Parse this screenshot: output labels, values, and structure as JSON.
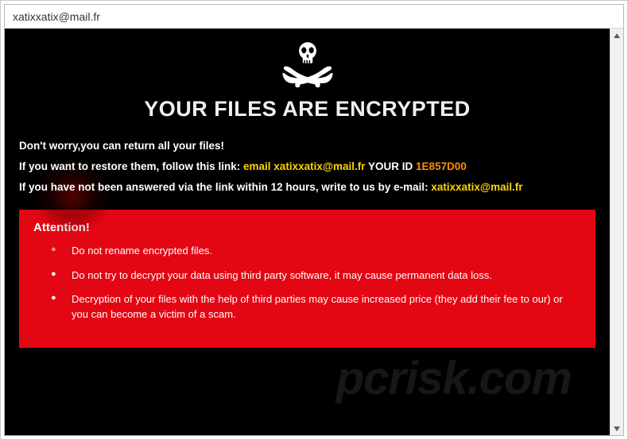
{
  "window": {
    "title": "xatixxatix@mail.fr"
  },
  "heading": "YOUR FILES ARE ENCRYPTED",
  "line1": "Don't worry,you can return all your files!",
  "line2": {
    "prefix": "If you want to restore them, follow this link: ",
    "email_label": "email xatixxatix@mail.fr",
    "id_label": "  YOUR ID ",
    "id_value": "1E857D00"
  },
  "line3": {
    "prefix": "If you have not been answered via the link ",
    "mid": "within 12 hours, write to us by e-mail: ",
    "email": "xatixxatix@mail.fr"
  },
  "attention": {
    "title": "Attention!",
    "items": [
      "Do not rename encrypted files.",
      "Do not try to decrypt your data using third party software, it may cause permanent data loss.",
      "Decryption of your files with the help of third parties may cause increased price (they add their fee to our) or you can become a victim of a scam."
    ]
  },
  "watermark": "pcrisk.com"
}
